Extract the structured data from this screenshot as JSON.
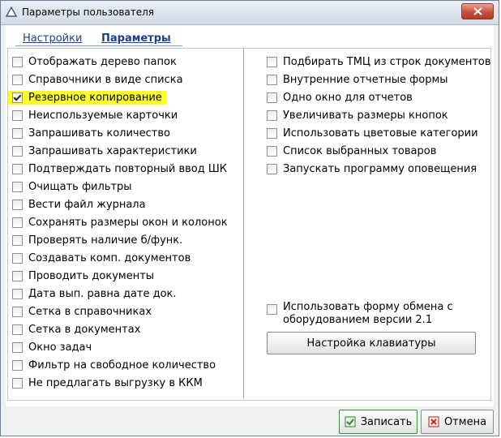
{
  "window": {
    "title": "Параметры пользователя"
  },
  "tabs": [
    {
      "label": "Настройки"
    },
    {
      "label": "Параметры"
    }
  ],
  "left_options": [
    {
      "label": "Отображать дерево папок",
      "checked": false
    },
    {
      "label": "Справочники в виде списка",
      "checked": false
    },
    {
      "label": "Резервное копирование",
      "checked": true,
      "highlight": true
    },
    {
      "label": "Неиспользуемые карточки",
      "checked": false
    },
    {
      "label": "Запрашивать количество",
      "checked": false
    },
    {
      "label": "Запрашивать характеристики",
      "checked": false
    },
    {
      "label": "Подтверждать повторный ввод ШК",
      "checked": false
    },
    {
      "label": "Очищать фильтры",
      "checked": false
    },
    {
      "label": "Вести файл журнала",
      "checked": false
    },
    {
      "label": "Сохранять размеры окон и колонок",
      "checked": false
    },
    {
      "label": "Проверять наличие б/функ.",
      "checked": false
    },
    {
      "label": "Создавать комп. документов",
      "checked": false
    },
    {
      "label": "Проводить документы",
      "checked": false
    },
    {
      "label": "Дата вып. равна дате док.",
      "checked": false
    },
    {
      "label": "Сетка в справочниках",
      "checked": false
    },
    {
      "label": "Сетка в документах",
      "checked": false
    },
    {
      "label": "Окно задач",
      "checked": false
    },
    {
      "label": "Фильтр на свободное количество",
      "checked": false
    },
    {
      "label": "Не предлагать выгрузку в ККМ",
      "checked": false
    }
  ],
  "right_options": [
    {
      "label": "Подбирать ТМЦ из строк документов",
      "checked": false
    },
    {
      "label": "Внутренние отчетные формы",
      "checked": false
    },
    {
      "label": "Одно окно для отчетов",
      "checked": false
    },
    {
      "label": "Увеличивать размеры кнопок",
      "checked": false
    },
    {
      "label": "Использовать цветовые категории",
      "checked": false
    },
    {
      "label": "Список выбранных товаров",
      "checked": false
    },
    {
      "label": "Запускать программу оповещения",
      "checked": false
    }
  ],
  "exchange_option": {
    "line1": "Использовать форму обмена с",
    "line2": "оборудованием версии 2.1",
    "checked": false
  },
  "keyboard_button": "Настройка клавиатуры",
  "buttons": {
    "save": "Записать",
    "cancel": "Отмена"
  },
  "colors": {
    "highlight": "#ffff28",
    "link": "#1a3f8c"
  }
}
